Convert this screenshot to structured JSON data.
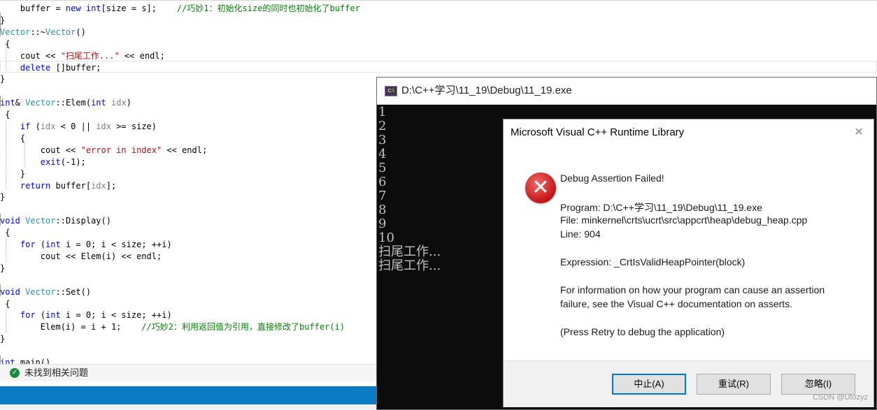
{
  "editor": {
    "lines": [
      {
        "t": "    buffer = new int[size = s];    //巧妙1：初始化size的同时也初始化了buffer"
      },
      {
        "t": "}"
      },
      {
        "t": "Vector::~Vector()"
      },
      {
        "t": " {"
      },
      {
        "t": "    cout << \"扫尾工作...\" << endl;"
      },
      {
        "t": "    delete []buffer;"
      },
      {
        "t": "}"
      },
      {
        "t": ""
      },
      {
        "t": "int& Vector::Elem(int idx)"
      },
      {
        "t": " {"
      },
      {
        "t": "    if (idx < 0 || idx >= size)"
      },
      {
        "t": "    {"
      },
      {
        "t": "        cout << \"error in index\" << endl;"
      },
      {
        "t": "        exit(-1);"
      },
      {
        "t": "    }"
      },
      {
        "t": "    return buffer[idx];"
      },
      {
        "t": "}"
      },
      {
        "t": ""
      },
      {
        "t": "void Vector::Display()"
      },
      {
        "t": " {"
      },
      {
        "t": "    for (int i = 0; i < size; ++i)"
      },
      {
        "t": "        cout << Elem(i) << endl;"
      },
      {
        "t": "}"
      },
      {
        "t": ""
      },
      {
        "t": "void Vector::Set()"
      },
      {
        "t": " {"
      },
      {
        "t": "    for (int i = 0; i < size; ++i)"
      },
      {
        "t": "        Elem(i) = i + 1;    //巧妙2：利用返回值为引用，直接修改了buffer(i)"
      },
      {
        "t": "}"
      },
      {
        "t": ""
      },
      {
        "t": "int main()"
      }
    ]
  },
  "status": {
    "icon": "check-circle-icon",
    "text": "未找到相关问题",
    "accent": "#0a7bc5"
  },
  "console": {
    "title": "D:\\C++学习\\11_19\\Debug\\11_19.exe",
    "icon_text": "C:\\",
    "output": [
      "1",
      "2",
      "3",
      "4",
      "5",
      "6",
      "7",
      "8",
      "9",
      "10",
      "扫尾工作...",
      "扫尾工作..."
    ]
  },
  "dialog": {
    "title": "Microsoft Visual C++ Runtime Library",
    "close": "✕",
    "icon": "error-icon",
    "headline": "Debug Assertion Failed!",
    "program": "Program: D:\\C++学习\\11_19\\Debug\\11_19.exe",
    "file": "File: minkernel\\crts\\ucrt\\src\\appcrt\\heap\\debug_heap.cpp",
    "line": "Line: 904",
    "expression": "Expression: _CrtIsValidHeapPointer(block)",
    "info1": "For information on how your program can cause an assertion",
    "info2": "failure, see the Visual C++ documentation on asserts.",
    "retry_hint": "(Press Retry to debug the application)",
    "buttons": {
      "abort": "中止(A)",
      "retry": "重试(R)",
      "ignore": "忽略(I)"
    }
  },
  "watermark": "CSDN @Utozyz"
}
